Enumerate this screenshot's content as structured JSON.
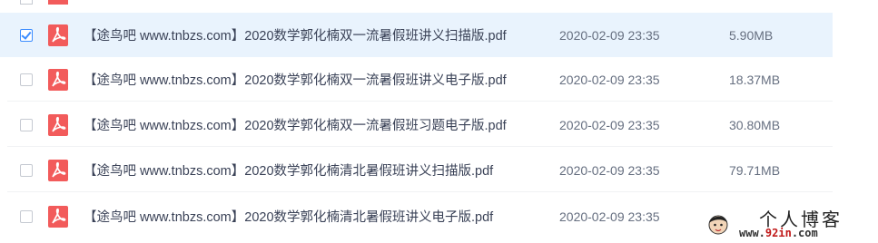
{
  "files": [
    {
      "name": "【途鸟吧 www.tnbzs.com】2020数学郭化楠双一流暑假班讲义扫描版.pdf",
      "date": "2020-02-09 23:35",
      "size": "5.90MB",
      "checked": true
    },
    {
      "name": "【途鸟吧 www.tnbzs.com】2020数学郭化楠双一流暑假班讲义电子版.pdf",
      "date": "2020-02-09 23:35",
      "size": "18.37MB",
      "checked": false
    },
    {
      "name": "【途鸟吧 www.tnbzs.com】2020数学郭化楠双一流暑假班习题电子版.pdf",
      "date": "2020-02-09 23:35",
      "size": "30.80MB",
      "checked": false
    },
    {
      "name": "【途鸟吧 www.tnbzs.com】2020数学郭化楠清北暑假班讲义扫描版.pdf",
      "date": "2020-02-09 23:35",
      "size": "79.71MB",
      "checked": false
    },
    {
      "name": "【途鸟吧 www.tnbzs.com】2020数学郭化楠清北暑假班讲义电子版.pdf",
      "date": "2020-02-09 23:35",
      "size": "",
      "checked": false
    }
  ],
  "watermark": {
    "title": "个人博客",
    "url_prefix": "www.",
    "url_accent": "92in",
    "url_suffix": ".com"
  },
  "icons": {
    "file_type": "pdf-file-icon",
    "selection": "checkbox"
  },
  "colors": {
    "selected_row": "#e9f3fd",
    "pdf_icon": "#f25b5b",
    "checkbox_checked": "#3b8cff"
  }
}
